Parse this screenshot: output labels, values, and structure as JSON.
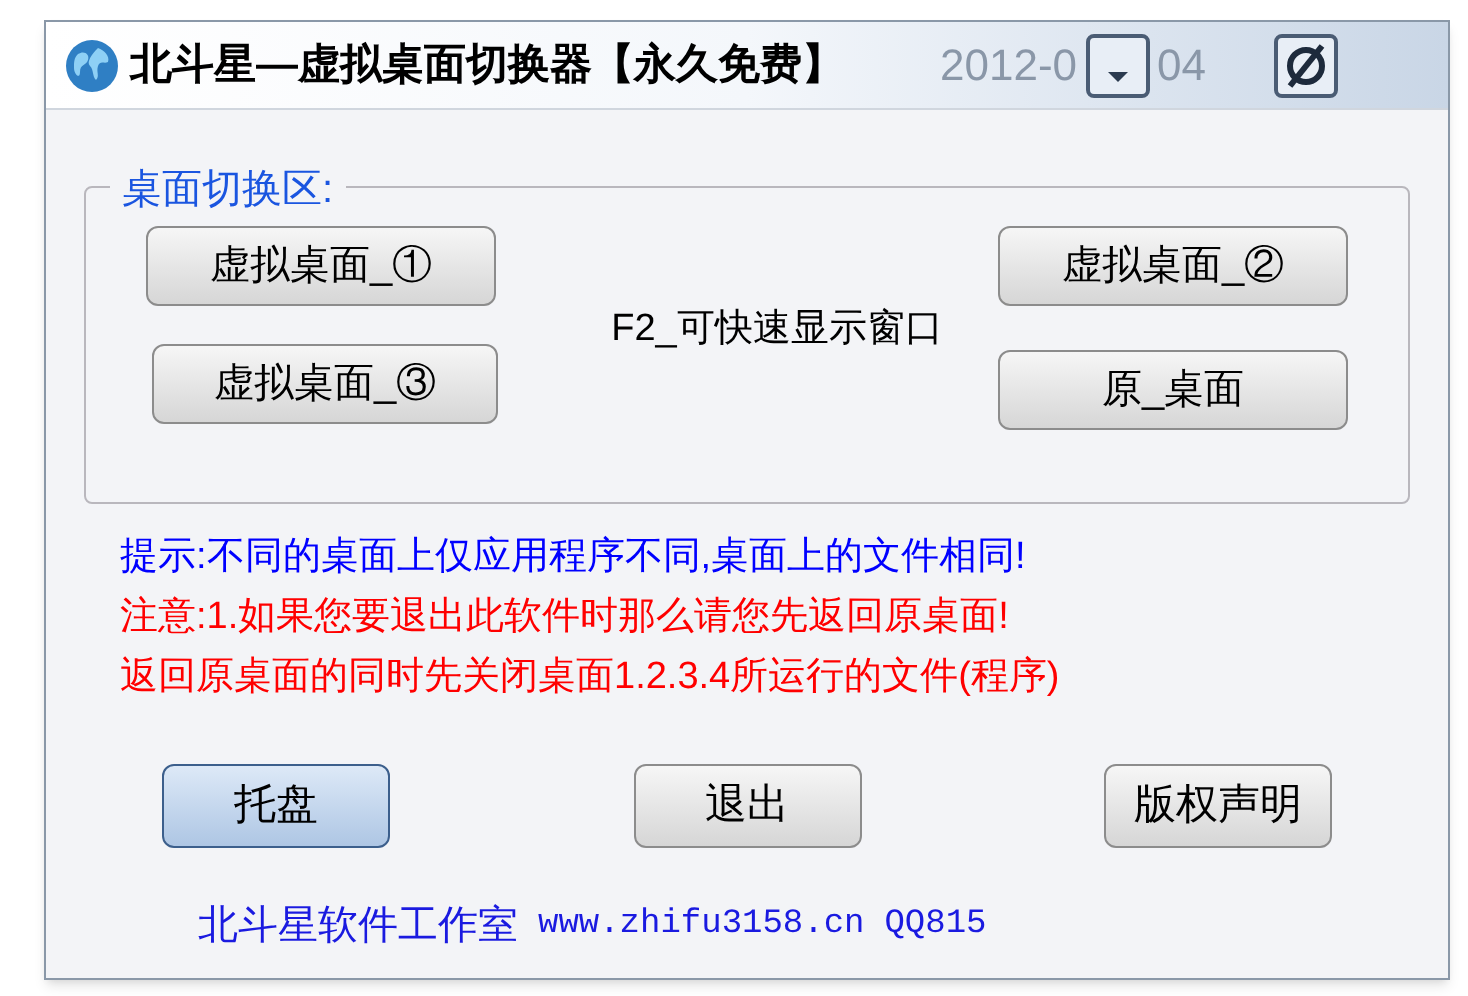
{
  "window": {
    "title": "北斗星—虚拟桌面切换器【永久免费】",
    "date_fragments": [
      "2012-0",
      "04"
    ]
  },
  "group": {
    "title": "桌面切换区:",
    "hint": "F2_可快速显示窗口",
    "buttons": [
      {
        "label": "虚拟桌面_①"
      },
      {
        "label": "虚拟桌面_②"
      },
      {
        "label": "虚拟桌面_③"
      },
      {
        "label": "原_桌面"
      }
    ]
  },
  "notes": [
    {
      "text": "提示:不同的桌面上仅应用程序不同,桌面上的文件相同!",
      "color": "#0000ff"
    },
    {
      "text": "注意:1.如果您要退出此软件时那么请您先返回原桌面!",
      "color": "#ff0000"
    },
    {
      "text": "返回原桌面的同时先关闭桌面1.2.3.4所运行的文件(程序)",
      "color": "#ff0000"
    }
  ],
  "buttons": [
    {
      "label": "托盘",
      "selected": true
    },
    {
      "label": "退出",
      "selected": false
    },
    {
      "label": "版权声明",
      "selected": false
    }
  ],
  "footer": {
    "studio": "北斗星软件工作室",
    "url": "www.zhifu3158.cn",
    "qq": "QQ815"
  }
}
